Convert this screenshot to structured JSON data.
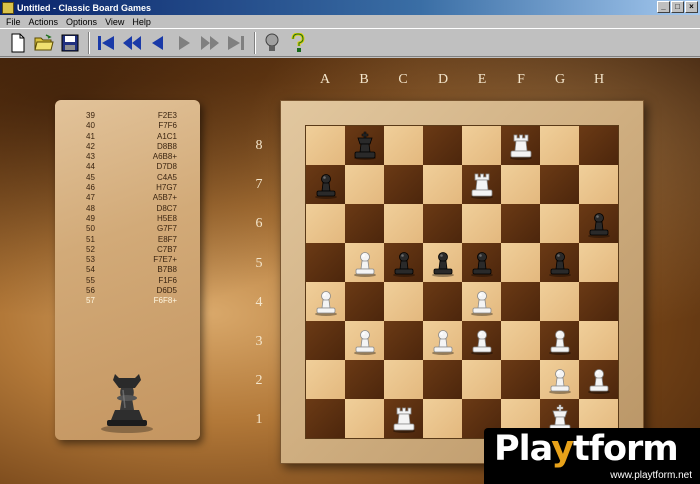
{
  "window": {
    "title": "Untitled - Classic Board Games",
    "buttons": {
      "minimize": "_",
      "maximize": "□",
      "close": "×"
    }
  },
  "menu": [
    "File",
    "Actions",
    "Options",
    "View",
    "Help"
  ],
  "toolbar": {
    "buttons": [
      {
        "name": "new-button",
        "icon": "new-document-icon"
      },
      {
        "name": "open-button",
        "icon": "open-folder-icon"
      },
      {
        "name": "save-button",
        "icon": "save-disk-icon"
      },
      {
        "name": "first-move-button",
        "icon": "skip-first-icon"
      },
      {
        "name": "rewind-button",
        "icon": "rewind-icon"
      },
      {
        "name": "previous-move-button",
        "icon": "step-back-icon"
      },
      {
        "name": "next-move-button",
        "icon": "step-forward-icon"
      },
      {
        "name": "fast-forward-button",
        "icon": "fast-forward-icon"
      },
      {
        "name": "last-move-button",
        "icon": "skip-last-icon"
      },
      {
        "name": "hint-button",
        "icon": "lightbulb-icon"
      },
      {
        "name": "help-button",
        "icon": "question-mark-icon"
      }
    ]
  },
  "colors": {
    "toolbar_icon_blue": "#1a3aa8",
    "board_light": "#e9c48c",
    "board_dark": "#5c2f10"
  },
  "moves": [
    {
      "num": "39",
      "move": "F2E3"
    },
    {
      "num": "40",
      "move": "F7F6"
    },
    {
      "num": "41",
      "move": "A1C1"
    },
    {
      "num": "42",
      "move": "D8B8"
    },
    {
      "num": "43",
      "move": "A6B8+"
    },
    {
      "num": "44",
      "move": "D7D8"
    },
    {
      "num": "45",
      "move": "C4A5"
    },
    {
      "num": "46",
      "move": "H7G7"
    },
    {
      "num": "47",
      "move": "A5B7+"
    },
    {
      "num": "48",
      "move": "D8C7"
    },
    {
      "num": "49",
      "move": "H5E8"
    },
    {
      "num": "50",
      "move": "G7F7"
    },
    {
      "num": "51",
      "move": "E8F7"
    },
    {
      "num": "52",
      "move": "C7B7"
    },
    {
      "num": "53",
      "move": "F7E7+"
    },
    {
      "num": "54",
      "move": "B7B8"
    },
    {
      "num": "55",
      "move": "F1F6"
    },
    {
      "num": "56",
      "move": "D6D5"
    },
    {
      "num": "57",
      "move": "F6F8+"
    }
  ],
  "current_move_index": 18,
  "side_to_move_piece": "black-king",
  "files": [
    "A",
    "B",
    "C",
    "D",
    "E",
    "F",
    "G",
    "H"
  ],
  "ranks": [
    "8",
    "7",
    "6",
    "5",
    "4",
    "3",
    "2",
    "1"
  ],
  "pieces": [
    {
      "square": "B8",
      "color": "black",
      "type": "king"
    },
    {
      "square": "F8",
      "color": "white",
      "type": "rook"
    },
    {
      "square": "A7",
      "color": "black",
      "type": "pawn"
    },
    {
      "square": "E7",
      "color": "white",
      "type": "rook"
    },
    {
      "square": "H6",
      "color": "black",
      "type": "pawn"
    },
    {
      "square": "B5",
      "color": "white",
      "type": "pawn"
    },
    {
      "square": "C5",
      "color": "black",
      "type": "pawn"
    },
    {
      "square": "D5",
      "color": "black",
      "type": "pawn"
    },
    {
      "square": "E5",
      "color": "black",
      "type": "pawn"
    },
    {
      "square": "G5",
      "color": "black",
      "type": "pawn"
    },
    {
      "square": "A4",
      "color": "white",
      "type": "pawn"
    },
    {
      "square": "E4",
      "color": "white",
      "type": "pawn"
    },
    {
      "square": "B3",
      "color": "white",
      "type": "pawn"
    },
    {
      "square": "D3",
      "color": "white",
      "type": "pawn"
    },
    {
      "square": "E3",
      "color": "white",
      "type": "pawn"
    },
    {
      "square": "G3",
      "color": "white",
      "type": "pawn"
    },
    {
      "square": "G2",
      "color": "white",
      "type": "pawn"
    },
    {
      "square": "H2",
      "color": "white",
      "type": "pawn"
    },
    {
      "square": "C1",
      "color": "white",
      "type": "rook"
    },
    {
      "square": "G1",
      "color": "white",
      "type": "king"
    }
  ],
  "watermark": {
    "brand_pre": "Pla",
    "brand_hl": "y",
    "brand_post": "tform",
    "url": "www.playtform.net"
  }
}
